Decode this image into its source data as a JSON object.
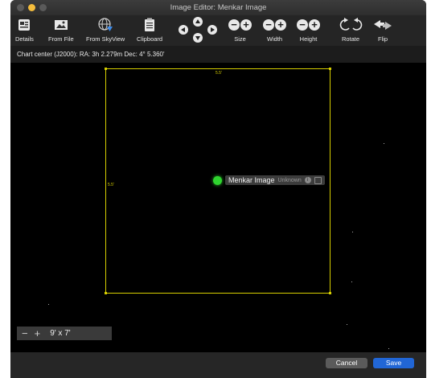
{
  "window": {
    "title": "Image Editor: Menkar Image"
  },
  "toolbar": {
    "details": "Details",
    "from_file": "From File",
    "from_skyview": "From SkyView",
    "clipboard": "Clipboard",
    "size": "Size",
    "width": "Width",
    "height": "Height",
    "rotate": "Rotate",
    "flip": "Flip",
    "minus_glyph": "−",
    "plus_glyph": "+"
  },
  "status": {
    "chart_center": "Chart center (J2000): RA: 3h 2.279m Dec: 4° 5.360'"
  },
  "frame": {
    "width_label": "5.5'",
    "height_label": "5.5'"
  },
  "object": {
    "name": "Menkar Image",
    "source": "Unknown",
    "info_glyph": "i"
  },
  "zoom": {
    "minus": "−",
    "plus": "+",
    "value": "9' x 7'"
  },
  "footer": {
    "cancel": "Cancel",
    "save": "Save"
  },
  "colors": {
    "frame": "#d8d000",
    "object_marker": "#2fd42f",
    "save_button": "#2166d6"
  },
  "icons": [
    "details-icon",
    "image-file-icon",
    "skyview-globe-icon",
    "clipboard-icon",
    "pan-arrows-icon",
    "size-minus-plus-icon",
    "width-minus-plus-icon",
    "height-minus-plus-icon",
    "rotate-icon",
    "flip-icon"
  ]
}
